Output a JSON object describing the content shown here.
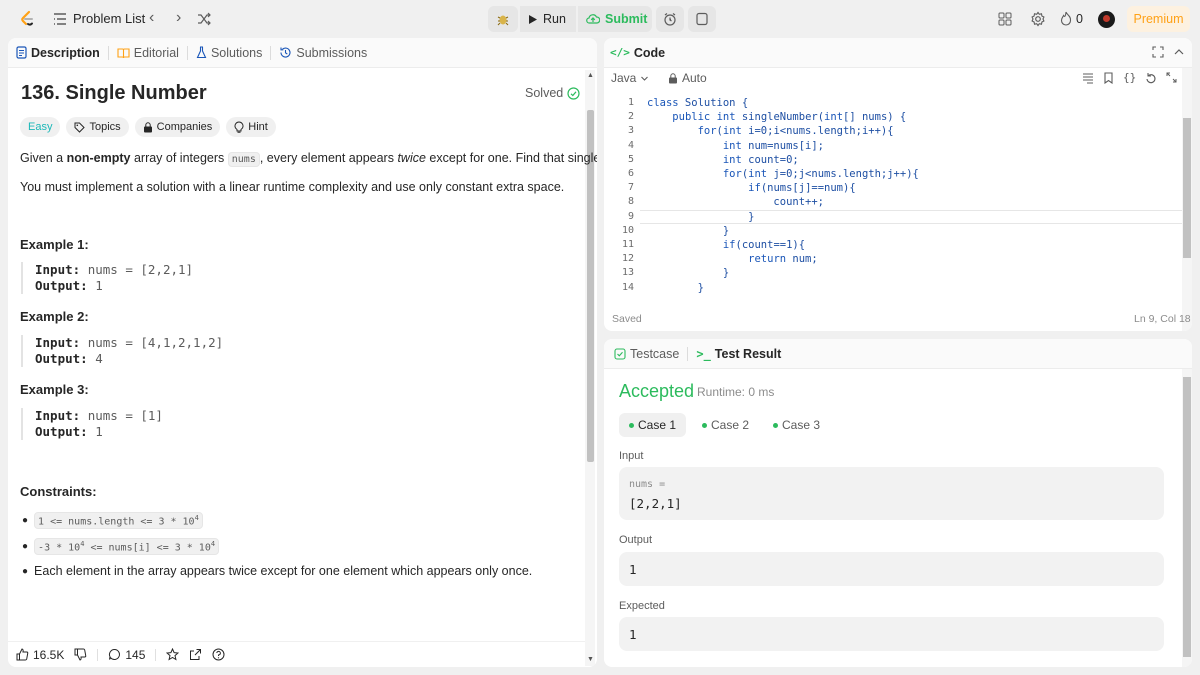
{
  "topbar": {
    "problem_list": "Problem List",
    "run": "Run",
    "submit": "Submit",
    "streak": "0",
    "premium": "Premium"
  },
  "left_tabs": {
    "description": "Description",
    "editorial": "Editorial",
    "solutions": "Solutions",
    "submissions": "Submissions"
  },
  "problem": {
    "title": "136. Single Number",
    "status": "Solved",
    "difficulty": "Easy",
    "tags": [
      "Topics",
      "Companies",
      "Hint"
    ],
    "desc_pre": "Given a",
    "desc_bold": "non-empty",
    "desc_mid": "array of integers",
    "desc_code": "nums",
    "desc_post1": ", every element appears",
    "desc_italic": "twice",
    "desc_post2": "except for one. Find that single one.",
    "desc2": "You must implement a solution with a linear runtime complexity and use only constant extra space.",
    "examples": [
      {
        "title": "Example 1:",
        "input_label": "Input:",
        "input": "nums = [2,2,1]",
        "output_label": "Output:",
        "output": "1"
      },
      {
        "title": "Example 2:",
        "input_label": "Input:",
        "input": "nums = [4,1,2,1,2]",
        "output_label": "Output:",
        "output": "4"
      },
      {
        "title": "Example 3:",
        "input_label": "Input:",
        "input": "nums = [1]",
        "output_label": "Output:",
        "output": "1"
      }
    ],
    "constraints_title": "Constraints:",
    "constraints": [
      {
        "text": "1 <= nums.length <= 3 * 10",
        "sup": "4"
      },
      {
        "text": "-3 * 10",
        "sup": "4",
        "text2": " <= nums[i] <= 3 * 10",
        "sup2": "4"
      },
      {
        "text": "Each element in the array appears twice except for one element which appears only once."
      }
    ]
  },
  "footer": {
    "likes": "16.5K",
    "comments": "145"
  },
  "code": {
    "header": "Code",
    "language": "Java",
    "mode": "Auto",
    "saved": "Saved",
    "cursor": "Ln 9, Col 18",
    "lines": [
      "class Solution {",
      "    public int singleNumber(int[] nums) {",
      "        for(int i=0;i<nums.length;i++){",
      "            int num=nums[i];",
      "            int count=0;",
      "            for(int j=0;j<nums.length;j++){",
      "                if(nums[j]==num){",
      "                    count++;",
      "                }",
      "            }",
      "            if(count==1){",
      "                return num;",
      "            }",
      "        }"
    ],
    "line_numbers": [
      "1",
      "2",
      "3",
      "4",
      "5",
      "6",
      "7",
      "8",
      "9",
      "10",
      "11",
      "12",
      "13",
      "14"
    ]
  },
  "tests": {
    "testcase_tab": "Testcase",
    "result_tab": "Test Result",
    "verdict": "Accepted",
    "runtime": "Runtime: 0 ms",
    "cases": [
      "Case 1",
      "Case 2",
      "Case 3"
    ],
    "input_label": "Input",
    "input_var": "nums =",
    "input_value": "[2,2,1]",
    "output_label": "Output",
    "output_value": "1",
    "expected_label": "Expected",
    "expected_value": "1"
  },
  "colors": {
    "accent_green": "#2cbb5d",
    "easy": "#1cb8b8",
    "premium": "#ffa116",
    "link_blue": "#1a56b8"
  }
}
